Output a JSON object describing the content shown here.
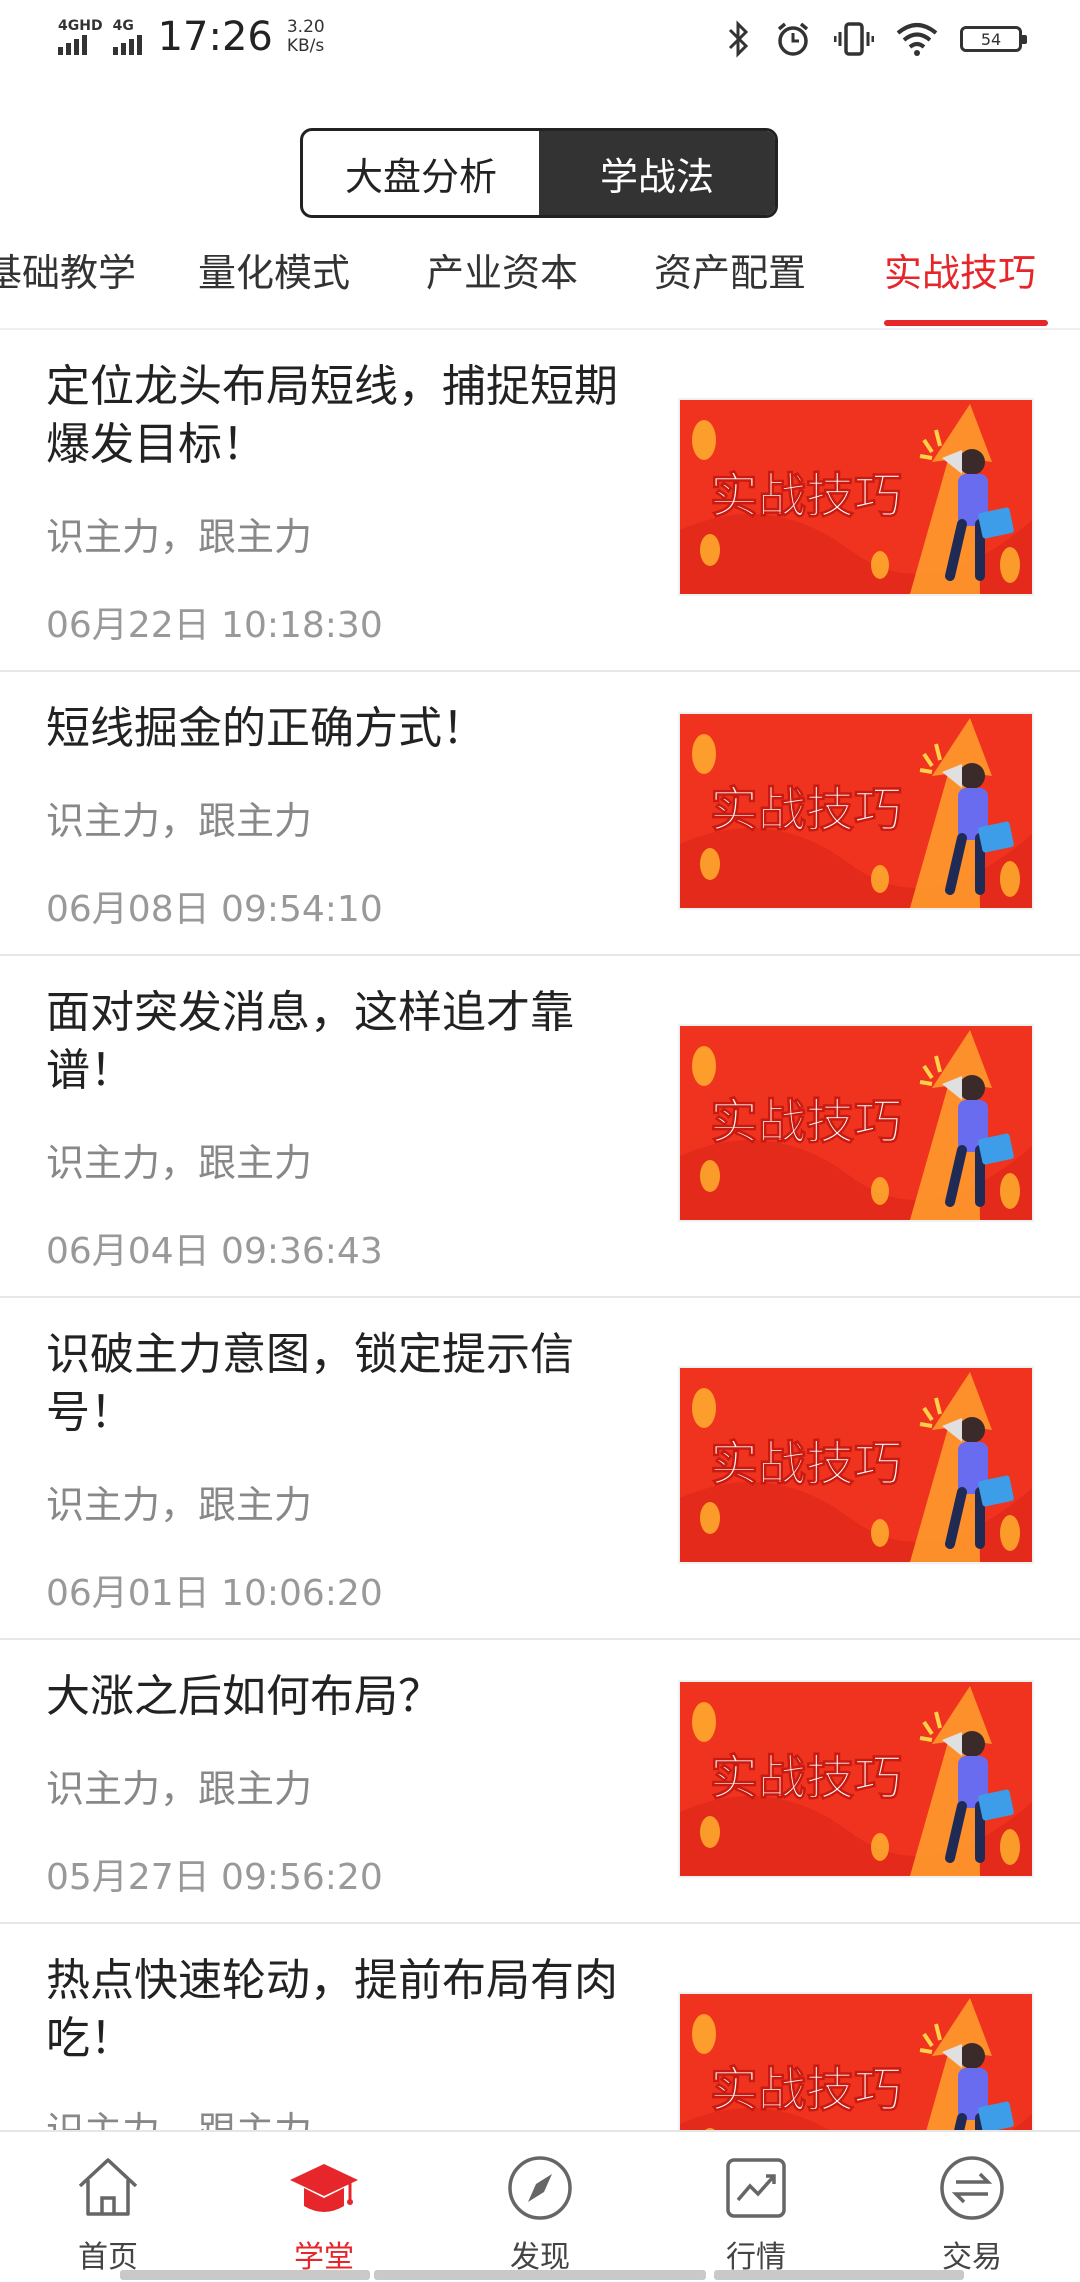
{
  "status_bar": {
    "network1": "4GHD",
    "network2": "4G",
    "time": "17:26",
    "speed_value": "3.20",
    "speed_unit": "KB/s",
    "battery": "54",
    "icons": [
      "bluetooth-icon",
      "alarm-icon",
      "vibrate-icon",
      "wifi-icon",
      "battery-icon"
    ]
  },
  "segment": {
    "options": [
      "大盘分析",
      "学战法"
    ],
    "active": "学战法"
  },
  "tabs": {
    "items": [
      "基础教学",
      "量化模式",
      "产业资本",
      "资产配置",
      "实战技巧"
    ],
    "active": "实战技巧"
  },
  "articles": [
    {
      "title": "定位龙头布局短线，捕捉短期爆发目标！",
      "tags": "识主力，跟主力",
      "date": "06月22日 10:18:30",
      "thumb_text": "实战技巧"
    },
    {
      "title": "短线掘金的正确方式！",
      "tags": "识主力，跟主力",
      "date": "06月08日 09:54:10",
      "thumb_text": "实战技巧"
    },
    {
      "title": "面对突发消息，这样追才靠谱！",
      "tags": "识主力，跟主力",
      "date": "06月04日 09:36:43",
      "thumb_text": "实战技巧"
    },
    {
      "title": "识破主力意图，锁定提示信号！",
      "tags": "识主力，跟主力",
      "date": "06月01日 10:06:20",
      "thumb_text": "实战技巧"
    },
    {
      "title": "大涨之后如何布局？",
      "tags": "识主力，跟主力",
      "date": "05月27日 09:56:20",
      "thumb_text": "实战技巧"
    },
    {
      "title": "热点快速轮动，提前布局有肉吃！",
      "tags": "识主力，跟主力",
      "date": "",
      "thumb_text": "实战技巧"
    }
  ],
  "bottom_nav": {
    "items": [
      {
        "label": "首页",
        "icon": "home-icon"
      },
      {
        "label": "学堂",
        "icon": "graduation-cap-icon"
      },
      {
        "label": "发现",
        "icon": "compass-icon"
      },
      {
        "label": "行情",
        "icon": "chart-icon"
      },
      {
        "label": "交易",
        "icon": "exchange-icon"
      }
    ],
    "active": "学堂"
  },
  "colors": {
    "accent": "#e6262a",
    "segment_active": "#333333",
    "thumb_bg": "#f0331f"
  }
}
